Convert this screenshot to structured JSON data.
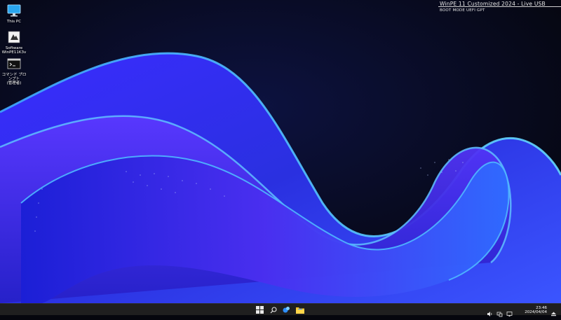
{
  "overlay": {
    "title": "WinPE 11 Customized 2024 - Live USB",
    "boot_mode": "BOOT MODE  UEFI GPT"
  },
  "desktop_icons": [
    {
      "label": "This PC",
      "icon": "computer-monitor-icon"
    },
    {
      "label": "Software\nWinPE11K3v",
      "icon": "software-icon"
    },
    {
      "label": "コマンド プロンプト\n(管理者)",
      "icon": "command-prompt-icon"
    }
  ],
  "taskbar": {
    "items": [
      {
        "name": "start",
        "icon": "windows-logo-icon"
      },
      {
        "name": "search",
        "icon": "search-icon"
      },
      {
        "name": "app",
        "icon": "app-icon"
      },
      {
        "name": "explorer",
        "icon": "folder-icon"
      }
    ],
    "tray": [
      "speaker-icon",
      "network-icon",
      "display-icon",
      "eject-icon"
    ],
    "time": "23:46",
    "date": "2024/04/04"
  },
  "colors": {
    "background": "#05060d",
    "accent_blue": "#2a3cff",
    "taskbar": "#1f1f1f",
    "folder_yellow": "#f4c430"
  }
}
